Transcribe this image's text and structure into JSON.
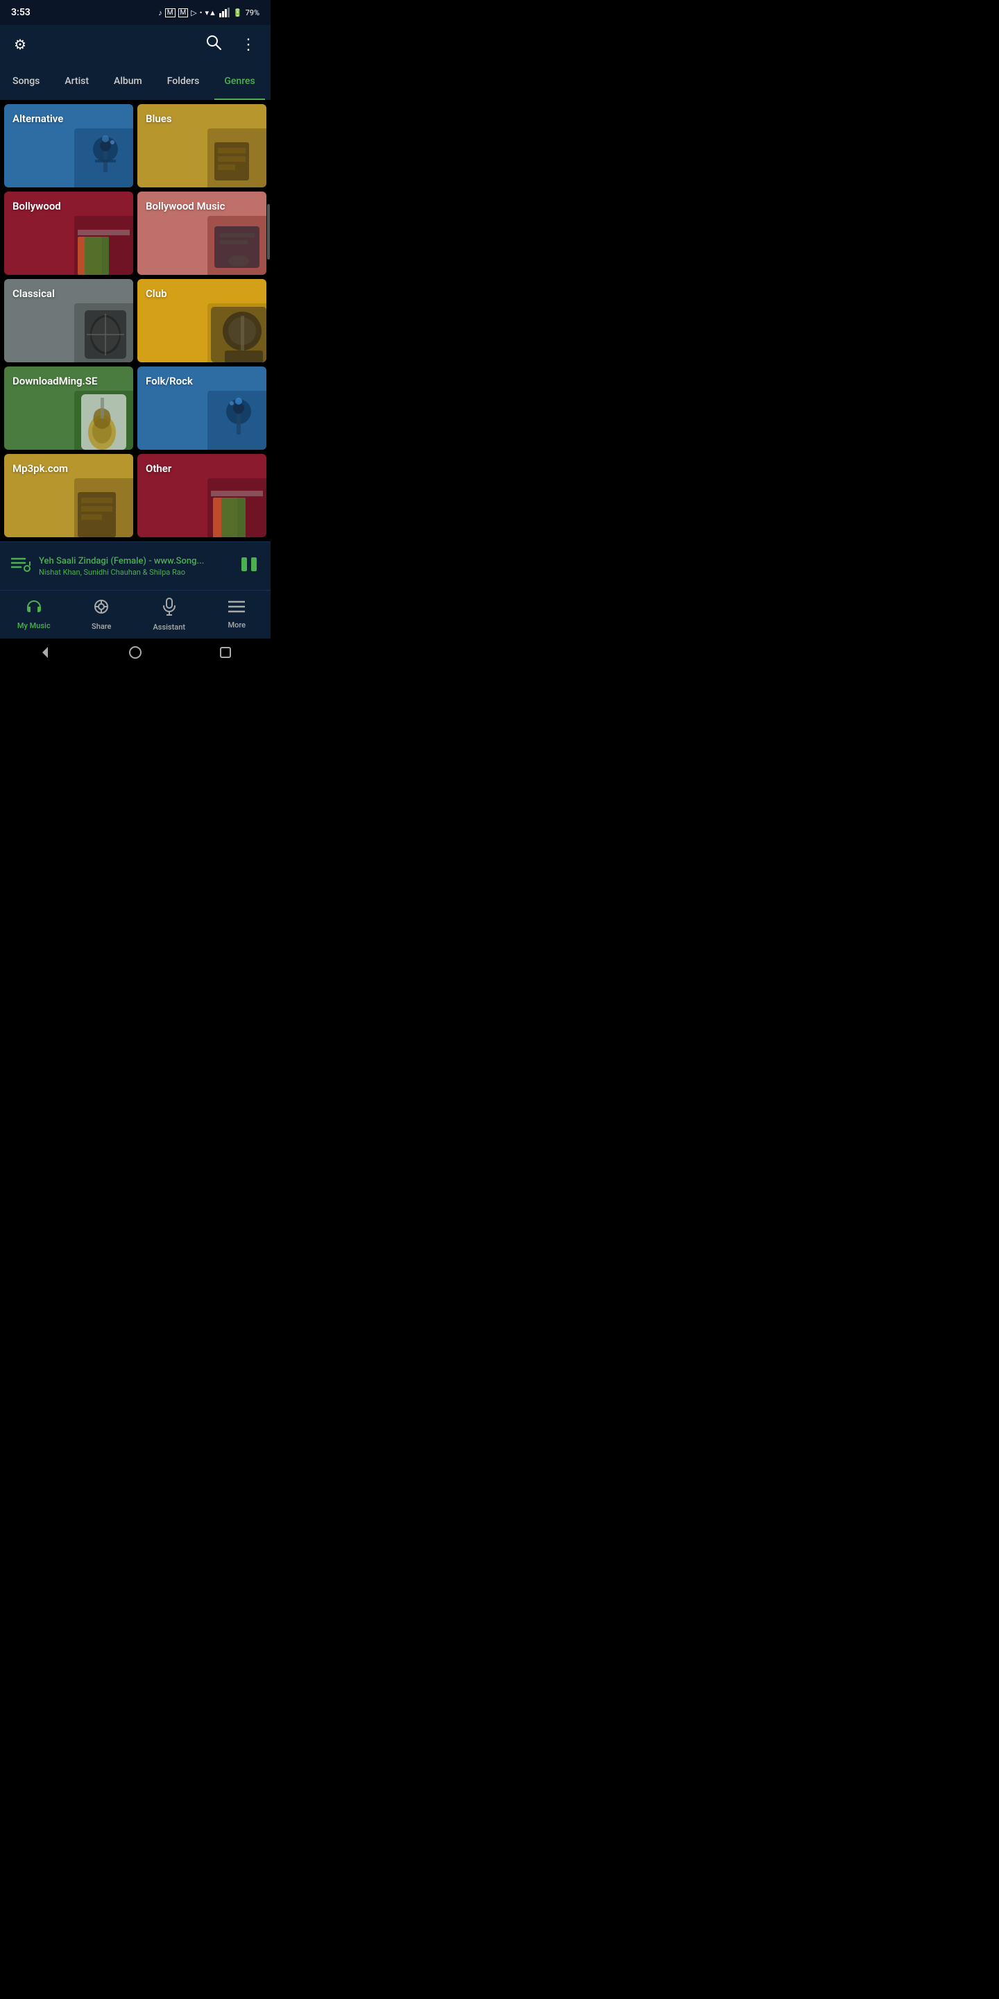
{
  "statusBar": {
    "time": "3:53",
    "battery": "79%",
    "icons": [
      "♪",
      "M",
      "M",
      "▷",
      "•",
      "wifi",
      "signal",
      "battery"
    ]
  },
  "topBar": {
    "settingsIcon": "⚙",
    "searchIcon": "🔍",
    "moreIcon": "⋮"
  },
  "tabs": [
    {
      "id": "songs",
      "label": "Songs",
      "active": false
    },
    {
      "id": "artist",
      "label": "Artist",
      "active": false
    },
    {
      "id": "album",
      "label": "Album",
      "active": false
    },
    {
      "id": "folders",
      "label": "Folders",
      "active": false
    },
    {
      "id": "genres",
      "label": "Genres",
      "active": true
    }
  ],
  "genres": [
    {
      "id": "alternative",
      "label": "Alternative",
      "colorClass": "card-alternative"
    },
    {
      "id": "blues",
      "label": "Blues",
      "colorClass": "card-blues"
    },
    {
      "id": "bollywood",
      "label": "Bollywood",
      "colorClass": "card-bollywood"
    },
    {
      "id": "bollywood-music",
      "label": "Bollywood Music",
      "colorClass": "card-bollywood-music"
    },
    {
      "id": "classical",
      "label": "Classical",
      "colorClass": "card-classical"
    },
    {
      "id": "club",
      "label": "Club",
      "colorClass": "card-club"
    },
    {
      "id": "downloadming",
      "label": "DownloadMing.SE",
      "colorClass": "card-downloadming"
    },
    {
      "id": "folk-rock",
      "label": "Folk/Rock",
      "colorClass": "card-folk-rock"
    },
    {
      "id": "mp3pk",
      "label": "Mp3pk.com",
      "colorClass": "card-mp3pk"
    },
    {
      "id": "other",
      "label": "Other",
      "colorClass": "card-other"
    }
  ],
  "nowPlaying": {
    "title": "Yeh Saali Zindagi (Female) - www.Song...",
    "artist": "Nishat Khan, Sunidhi Chauhan & Shilpa Rao"
  },
  "bottomNav": [
    {
      "id": "my-music",
      "label": "My Music",
      "icon": "headphones",
      "active": true
    },
    {
      "id": "share",
      "label": "Share",
      "icon": "share",
      "active": false
    },
    {
      "id": "assistant",
      "label": "Assistant",
      "icon": "mic",
      "active": false
    },
    {
      "id": "more",
      "label": "More",
      "icon": "menu",
      "active": false
    }
  ]
}
